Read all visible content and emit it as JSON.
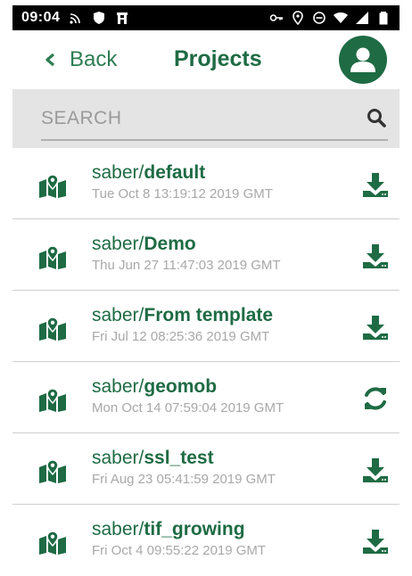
{
  "status_bar": {
    "time": "09:04",
    "left_icons": [
      "cast-icon",
      "shield-icon",
      "tower-icon"
    ],
    "right_icons": [
      "key-icon",
      "location-icon",
      "dnd-icon",
      "wifi-icon",
      "signal-icon",
      "battery-icon"
    ]
  },
  "header": {
    "back_label": "Back",
    "title": "Projects",
    "avatar_icon": "user-icon"
  },
  "search": {
    "placeholder": "SEARCH",
    "value": ""
  },
  "colors": {
    "primary": "#1e6b44",
    "secondary_text": "#a8a8a8",
    "search_bg": "#e4e4e4"
  },
  "projects": [
    {
      "owner": "saber/",
      "name": "default",
      "date": "Tue Oct 8 13:19:12 2019 GMT",
      "action": "download-icon"
    },
    {
      "owner": "saber/",
      "name": "Demo",
      "date": "Thu Jun 27 11:47:03 2019 GMT",
      "action": "download-icon"
    },
    {
      "owner": "saber/",
      "name": "From template",
      "date": "Fri Jul 12 08:25:36 2019 GMT",
      "action": "download-icon"
    },
    {
      "owner": "saber/",
      "name": "geomob",
      "date": "Mon Oct 14 07:59:04 2019 GMT",
      "action": "sync-icon"
    },
    {
      "owner": "saber/",
      "name": "ssl_test",
      "date": "Fri Aug 23 05:41:59 2019 GMT",
      "action": "download-icon"
    },
    {
      "owner": "saber/",
      "name": "tif_growing",
      "date": "Fri Oct 4 09:55:22 2019 GMT",
      "action": "download-icon"
    }
  ]
}
